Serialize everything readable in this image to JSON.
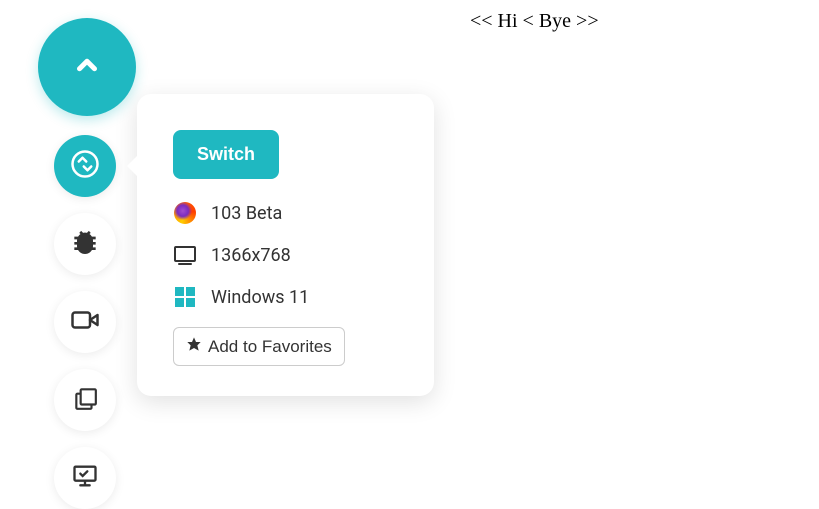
{
  "header": {
    "text": "<< Hi < Bye >>"
  },
  "popup": {
    "switch_label": "Switch",
    "browser": "103 Beta",
    "resolution": "1366x768",
    "os": "Windows 11",
    "favorites_label": "Add to Favorites"
  }
}
